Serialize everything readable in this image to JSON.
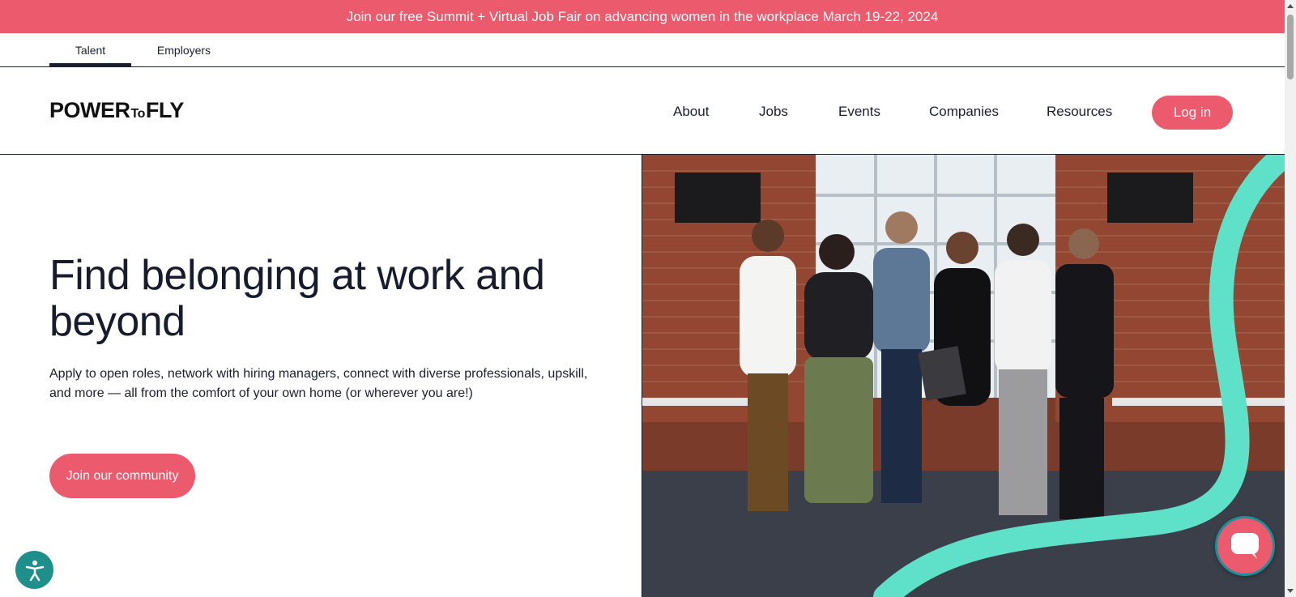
{
  "banner": {
    "text": "Join our free Summit + Virtual Job Fair on advancing women in the workplace March 19-22, 2024"
  },
  "audience_tabs": [
    {
      "label": "Talent",
      "active": true
    },
    {
      "label": "Employers",
      "active": false
    }
  ],
  "logo": {
    "part1": "POWER",
    "part2": "To",
    "part3": "FLY"
  },
  "nav": {
    "items": [
      "About",
      "Jobs",
      "Events",
      "Companies",
      "Resources"
    ],
    "login_label": "Log in"
  },
  "hero": {
    "title": "Find belonging at work and beyond",
    "subtitle": "Apply to open roles, network with hiring managers, connect with diverse professionals, upskill, and more — all from the comfort of your own home (or wherever you are!)",
    "cta_label": "Join our community"
  },
  "colors": {
    "brand": "#ec5a6e",
    "accent_teal": "#5fe0c8",
    "text_dark": "#161b2e"
  },
  "icons": {
    "accessibility": "accessibility-icon",
    "chat": "chat-icon"
  }
}
